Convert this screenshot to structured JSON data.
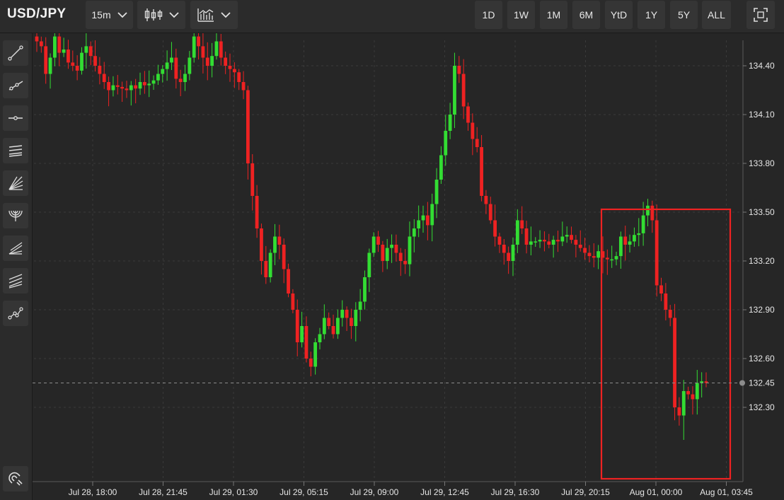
{
  "toolbar": {
    "symbol": "USD/JPY",
    "interval": "15m",
    "chart_style_icon": "candlestick-icon",
    "indicators_icon": "indicators-icon",
    "ranges": [
      "1D",
      "1W",
      "1M",
      "6M",
      "YtD",
      "1Y",
      "5Y",
      "ALL"
    ],
    "fullscreen_icon": "fullscreen-icon"
  },
  "sidebar": {
    "tools": [
      "trend-line-icon",
      "ray-line-icon",
      "horizontal-line-icon",
      "parallel-channel-icon",
      "fan-icon",
      "arc-icon",
      "pitchfork-icon",
      "regression-icon",
      "path-icon"
    ],
    "bottom_tool": "magnet-icon"
  },
  "colors": {
    "up": "#33dd33",
    "down": "#ee2222",
    "highlight_box": "#ee2222",
    "grid": "#3a3a3a",
    "background": "#262626"
  },
  "chart_data": {
    "type": "candlestick",
    "symbol": "USD/JPY",
    "interval": "15m",
    "current_price": 132.45,
    "y_ticks": [
      134.4,
      134.1,
      133.8,
      133.5,
      133.2,
      132.9,
      132.6,
      132.3
    ],
    "y_tick_labels": [
      "134.40",
      "134.10",
      "133.80",
      "133.50",
      "133.20",
      "132.90",
      "132.60",
      "132.30"
    ],
    "current_price_label": "132.45",
    "ylim": [
      132.0,
      134.68
    ],
    "x_tick_labels": [
      "Jul 28, 18:00",
      "Jul 28, 21:45",
      "Jul 29, 01:30",
      "Jul 29, 05:15",
      "Jul 29, 09:00",
      "Jul 29, 12:45",
      "Jul 29, 16:30",
      "Jul 29, 20:15",
      "Aug 01, 00:00",
      "Aug 01, 03:45"
    ],
    "grid": true,
    "closes": [
      134.55,
      134.52,
      134.35,
      134.45,
      134.58,
      134.48,
      134.5,
      134.42,
      134.4,
      134.37,
      134.48,
      134.52,
      134.46,
      134.4,
      134.35,
      134.3,
      134.25,
      134.28,
      134.27,
      134.26,
      134.25,
      134.28,
      134.26,
      134.3,
      134.28,
      134.29,
      134.31,
      134.35,
      134.38,
      134.42,
      134.45,
      134.32,
      134.3,
      134.35,
      134.45,
      134.58,
      134.52,
      134.45,
      134.4,
      134.46,
      134.55,
      134.45,
      134.4,
      134.38,
      134.36,
      134.3,
      134.25,
      133.8,
      133.6,
      133.4,
      133.2,
      133.1,
      133.25,
      133.35,
      133.3,
      133.15,
      133.0,
      132.9,
      132.7,
      132.8,
      132.6,
      132.55,
      132.7,
      132.75,
      132.85,
      132.8,
      132.75,
      132.85,
      132.9,
      132.85,
      132.8,
      132.9,
      132.95,
      133.1,
      133.25,
      133.35,
      133.3,
      133.2,
      133.28,
      133.3,
      133.25,
      133.2,
      133.18,
      133.35,
      133.4,
      133.45,
      133.48,
      133.42,
      133.55,
      133.7,
      133.85,
      134.0,
      134.1,
      134.4,
      134.35,
      134.15,
      134.05,
      133.95,
      133.9,
      133.6,
      133.55,
      133.45,
      133.35,
      133.3,
      133.25,
      133.2,
      133.3,
      133.45,
      133.4,
      133.3,
      133.32,
      133.32,
      133.33,
      133.32,
      133.3,
      133.33,
      133.32,
      133.35,
      133.36,
      133.33,
      133.3,
      133.28,
      133.25,
      133.23,
      133.22,
      133.26,
      133.22,
      133.21,
      133.21,
      133.23,
      133.35,
      133.3,
      133.32,
      133.36,
      133.37,
      133.48,
      133.54,
      133.45,
      133.05,
      133.0,
      132.9,
      132.85,
      132.3,
      132.25,
      132.4,
      132.38,
      132.35,
      132.45,
      132.46,
      132.45
    ]
  }
}
